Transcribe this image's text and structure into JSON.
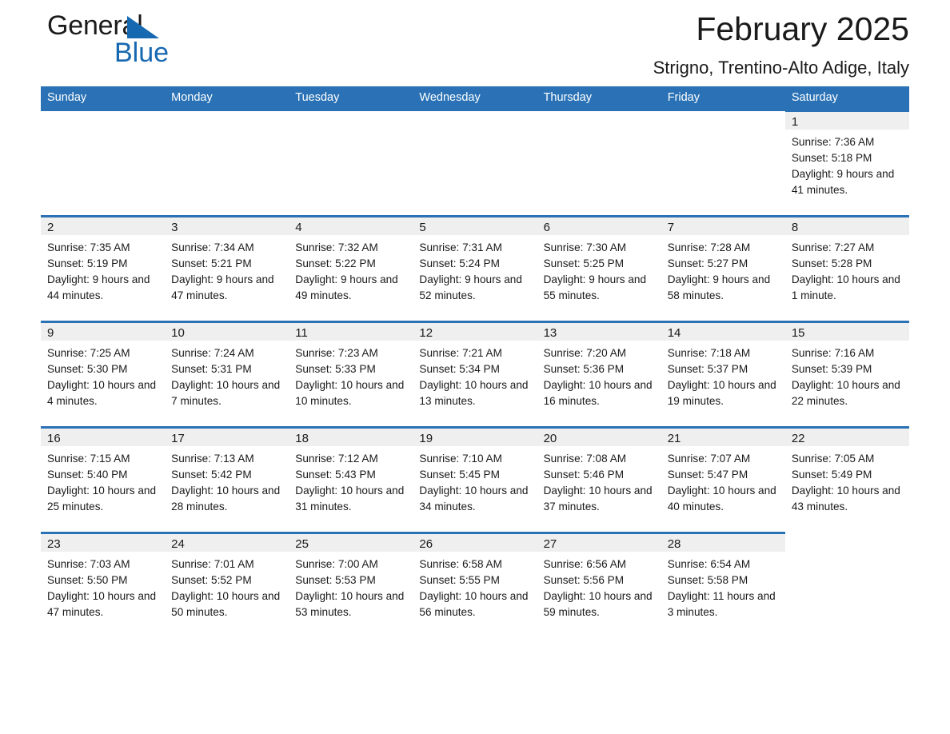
{
  "brand": {
    "name_part1": "General",
    "name_part2": "Blue",
    "triangle_color": "#1668b0"
  },
  "header": {
    "title": "February 2025",
    "subtitle": "Strigno, Trentino-Alto Adige, Italy",
    "accent_color": "#2a72b5",
    "daynum_band_color": "#efefef"
  },
  "calendar": {
    "weekday_headers": [
      "Sunday",
      "Monday",
      "Tuesday",
      "Wednesday",
      "Thursday",
      "Friday",
      "Saturday"
    ],
    "labels": {
      "sunrise": "Sunrise:",
      "sunset": "Sunset:",
      "daylight": "Daylight:"
    },
    "weeks": [
      [
        {
          "day": "",
          "blank": true
        },
        {
          "day": "",
          "blank": true
        },
        {
          "day": "",
          "blank": true
        },
        {
          "day": "",
          "blank": true
        },
        {
          "day": "",
          "blank": true
        },
        {
          "day": "",
          "blank": true
        },
        {
          "day": "1",
          "sunrise": "Sunrise: 7:36 AM",
          "sunset": "Sunset: 5:18 PM",
          "daylight": "Daylight: 9 hours and 41 minutes."
        }
      ],
      [
        {
          "day": "2",
          "sunrise": "Sunrise: 7:35 AM",
          "sunset": "Sunset: 5:19 PM",
          "daylight": "Daylight: 9 hours and 44 minutes."
        },
        {
          "day": "3",
          "sunrise": "Sunrise: 7:34 AM",
          "sunset": "Sunset: 5:21 PM",
          "daylight": "Daylight: 9 hours and 47 minutes."
        },
        {
          "day": "4",
          "sunrise": "Sunrise: 7:32 AM",
          "sunset": "Sunset: 5:22 PM",
          "daylight": "Daylight: 9 hours and 49 minutes."
        },
        {
          "day": "5",
          "sunrise": "Sunrise: 7:31 AM",
          "sunset": "Sunset: 5:24 PM",
          "daylight": "Daylight: 9 hours and 52 minutes."
        },
        {
          "day": "6",
          "sunrise": "Sunrise: 7:30 AM",
          "sunset": "Sunset: 5:25 PM",
          "daylight": "Daylight: 9 hours and 55 minutes."
        },
        {
          "day": "7",
          "sunrise": "Sunrise: 7:28 AM",
          "sunset": "Sunset: 5:27 PM",
          "daylight": "Daylight: 9 hours and 58 minutes."
        },
        {
          "day": "8",
          "sunrise": "Sunrise: 7:27 AM",
          "sunset": "Sunset: 5:28 PM",
          "daylight": "Daylight: 10 hours and 1 minute."
        }
      ],
      [
        {
          "day": "9",
          "sunrise": "Sunrise: 7:25 AM",
          "sunset": "Sunset: 5:30 PM",
          "daylight": "Daylight: 10 hours and 4 minutes."
        },
        {
          "day": "10",
          "sunrise": "Sunrise: 7:24 AM",
          "sunset": "Sunset: 5:31 PM",
          "daylight": "Daylight: 10 hours and 7 minutes."
        },
        {
          "day": "11",
          "sunrise": "Sunrise: 7:23 AM",
          "sunset": "Sunset: 5:33 PM",
          "daylight": "Daylight: 10 hours and 10 minutes."
        },
        {
          "day": "12",
          "sunrise": "Sunrise: 7:21 AM",
          "sunset": "Sunset: 5:34 PM",
          "daylight": "Daylight: 10 hours and 13 minutes."
        },
        {
          "day": "13",
          "sunrise": "Sunrise: 7:20 AM",
          "sunset": "Sunset: 5:36 PM",
          "daylight": "Daylight: 10 hours and 16 minutes."
        },
        {
          "day": "14",
          "sunrise": "Sunrise: 7:18 AM",
          "sunset": "Sunset: 5:37 PM",
          "daylight": "Daylight: 10 hours and 19 minutes."
        },
        {
          "day": "15",
          "sunrise": "Sunrise: 7:16 AM",
          "sunset": "Sunset: 5:39 PM",
          "daylight": "Daylight: 10 hours and 22 minutes."
        }
      ],
      [
        {
          "day": "16",
          "sunrise": "Sunrise: 7:15 AM",
          "sunset": "Sunset: 5:40 PM",
          "daylight": "Daylight: 10 hours and 25 minutes."
        },
        {
          "day": "17",
          "sunrise": "Sunrise: 7:13 AM",
          "sunset": "Sunset: 5:42 PM",
          "daylight": "Daylight: 10 hours and 28 minutes."
        },
        {
          "day": "18",
          "sunrise": "Sunrise: 7:12 AM",
          "sunset": "Sunset: 5:43 PM",
          "daylight": "Daylight: 10 hours and 31 minutes."
        },
        {
          "day": "19",
          "sunrise": "Sunrise: 7:10 AM",
          "sunset": "Sunset: 5:45 PM",
          "daylight": "Daylight: 10 hours and 34 minutes."
        },
        {
          "day": "20",
          "sunrise": "Sunrise: 7:08 AM",
          "sunset": "Sunset: 5:46 PM",
          "daylight": "Daylight: 10 hours and 37 minutes."
        },
        {
          "day": "21",
          "sunrise": "Sunrise: 7:07 AM",
          "sunset": "Sunset: 5:47 PM",
          "daylight": "Daylight: 10 hours and 40 minutes."
        },
        {
          "day": "22",
          "sunrise": "Sunrise: 7:05 AM",
          "sunset": "Sunset: 5:49 PM",
          "daylight": "Daylight: 10 hours and 43 minutes."
        }
      ],
      [
        {
          "day": "23",
          "sunrise": "Sunrise: 7:03 AM",
          "sunset": "Sunset: 5:50 PM",
          "daylight": "Daylight: 10 hours and 47 minutes."
        },
        {
          "day": "24",
          "sunrise": "Sunrise: 7:01 AM",
          "sunset": "Sunset: 5:52 PM",
          "daylight": "Daylight: 10 hours and 50 minutes."
        },
        {
          "day": "25",
          "sunrise": "Sunrise: 7:00 AM",
          "sunset": "Sunset: 5:53 PM",
          "daylight": "Daylight: 10 hours and 53 minutes."
        },
        {
          "day": "26",
          "sunrise": "Sunrise: 6:58 AM",
          "sunset": "Sunset: 5:55 PM",
          "daylight": "Daylight: 10 hours and 56 minutes."
        },
        {
          "day": "27",
          "sunrise": "Sunrise: 6:56 AM",
          "sunset": "Sunset: 5:56 PM",
          "daylight": "Daylight: 10 hours and 59 minutes."
        },
        {
          "day": "28",
          "sunrise": "Sunrise: 6:54 AM",
          "sunset": "Sunset: 5:58 PM",
          "daylight": "Daylight: 11 hours and 3 minutes."
        },
        {
          "day": "",
          "blank": true
        }
      ]
    ]
  }
}
